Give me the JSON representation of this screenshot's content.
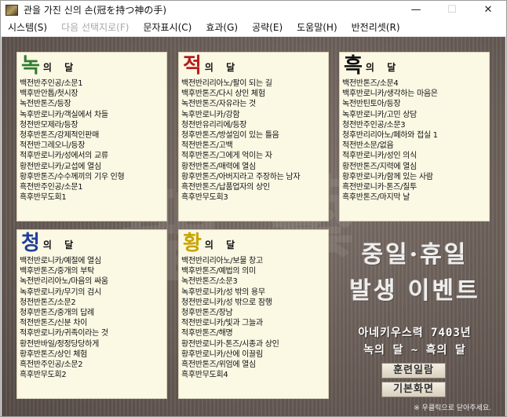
{
  "window": {
    "title_main": "관을 가진 신의 손(冠を持つ神の手)",
    "title_bracket": "[",
    "minimize": "—",
    "maximize": "☐",
    "close": "✕"
  },
  "menu": [
    {
      "label": "시스템(S)",
      "enabled": true
    },
    {
      "label": "다음 선택지로(F)",
      "enabled": false
    },
    {
      "label": "문자표시(C)",
      "enabled": true
    },
    {
      "label": "효과(G)",
      "enabled": true
    },
    {
      "label": "공략(E)",
      "enabled": true
    },
    {
      "label": "도움말(H)",
      "enabled": true
    },
    {
      "label": "반전리셋(R)",
      "enabled": true
    }
  ],
  "colors": {
    "green": "#2e7d2e",
    "red": "#b51d1d",
    "black": "#111111",
    "blue": "#1f3f9a",
    "yellow": "#c9a400"
  },
  "cards": [
    {
      "big": "녹",
      "rest": "의 달",
      "lines": [
        "백전반주인공/소문1",
        "백후반안톱/첫시장",
        "녹전반톤즈/등장",
        "녹후반로니카/객실에서 차들",
        "청전반모제라/등장",
        "청후반톤즈/강제적인판매",
        "적전반그레오니/등장",
        "적후반로니카/성에서의 교류",
        "황전반로니카/교섭에 열심",
        "황후반톤즈/수수께끼의 기우 인형",
        "흑전반주인공/소문1",
        "흑후반무도회1"
      ]
    },
    {
      "big": "적",
      "rest": "의 달",
      "lines": [
        "백전반리리아노/팔이 되는 길",
        "백후반톤즈/다시 상인 체험",
        "녹전반톤즈/자유라는 것",
        "녹후반로니카/강함",
        "청전반유리리에/등장",
        "청후반톤즈/방설임이 있는 틀음",
        "적전반톤즈/고백",
        "적후반톤즈/그에게 억이는 자",
        "황전반톤즈/매력에 열심",
        "황후반톤즈/아버지라고 주장하는 남자",
        "흑전반톤즈/납품업자의 상인",
        "흑후반무도회3"
      ]
    },
    {
      "big": "흑",
      "rest": "의 달",
      "lines": [
        "백전반톤즈/소문4",
        "백후반로니카/생각하는 마음은",
        "녹전반틴토아/등장",
        "녹후반로니카/고민 상담",
        "청전반주인공/소문3",
        "청후반리리아노/페하와 접실 1",
        "적전반소문/없음",
        "적후반로니카/성인 의식",
        "황전반톤즈/지력에 열심",
        "황후반로니카/함께 있는 사람",
        "흑전반로니카·톤즈/질투",
        "흑후반톤즈/마지막 날"
      ]
    },
    {
      "big": "청",
      "rest": "의 달",
      "lines": [
        "백전반로니카/예절에 열심",
        "백후반톤즈/중개의 부탁",
        "녹전반리리아노/마음의 싸움",
        "녹후반로니카/무기의 검시",
        "청전반톤즈/소문2",
        "청후반톤즈/중개의 답례",
        "적전반톤즈/신분 차이",
        "적후반로니카/귀족이라는 것",
        "황전반바일/정정당당하게",
        "황후반톤즈/상인 체험",
        "흑전반주인공/소문2",
        "흑후반무도회2"
      ]
    },
    {
      "big": "황",
      "rest": "의 달",
      "lines": [
        "백전반리리아노/보물 창고",
        "백후반톤즈/예법의 의미",
        "녹전반톤즈/소문3",
        "녹후반로니카/성 밖의 용무",
        "청전반로니카/성 밖으로 잠행",
        "청후반톤즈/장남",
        "적전반로니카/빛과 그늘과",
        "적후반톤즈/해명",
        "황전반로니카·톤즈/시종과 상인",
        "황후반로니카/산에 이끌림",
        "흑전반톤즈/위엄에 열심",
        "흑후반무도회4"
      ]
    }
  ],
  "side": {
    "line1": "중일·휴일",
    "line2": "발생 이벤트",
    "line3": "아네키우스력 7403년",
    "line4": "녹의 달 ~ 흑의 달",
    "btn1": "훈련일람",
    "btn2": "기본화면",
    "hint": "※ 우클릭으로 닫아주세요."
  },
  "deco": {
    "left": "聖",
    "right": "藝"
  }
}
